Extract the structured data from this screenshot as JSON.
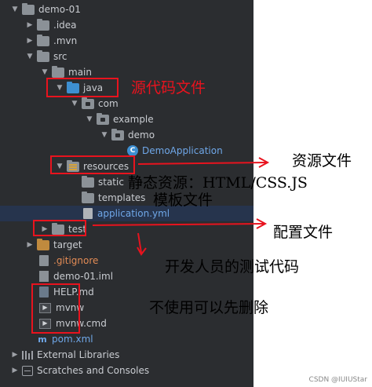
{
  "tree": {
    "root": "demo-01",
    "idea": ".idea",
    "mvn": ".mvn",
    "src": "src",
    "main": "main",
    "java": "java",
    "com": "com",
    "example": "example",
    "demo": "demo",
    "app_class": "DemoApplication",
    "app_class_icon": "C",
    "resources": "resources",
    "static": "static",
    "templates": "templates",
    "app_yml": "application.yml",
    "test": "test",
    "target": "target",
    "gitignore": ".gitignore",
    "iml": "demo-01.iml",
    "help": "HELP.md",
    "mvnw": "mvnw",
    "mvnw_cmd": "mvnw.cmd",
    "pom": "pom.xml",
    "external_libraries": "External Libraries",
    "scratches": "Scratches and Consoles",
    "pom_icon": "m",
    "mvnw_icon": "▶"
  },
  "annotations": {
    "source_files": "源代码文件",
    "resource_files": "资源文件",
    "static_resources": "静态资源：HTML/CSS.JS",
    "template_files": "模板文件",
    "config_files": "配置文件",
    "test_code": "开发人员的测试代码",
    "deletable": "不使用可以先删除"
  },
  "footer": "CSDN @IUIUStar",
  "colors": {
    "panel_bg": "#2b2d30",
    "annotation_red": "#e8131e",
    "selected_row": "#26344d",
    "folder_blue": "#3d8fd1",
    "ignored_orange": "#e28b55"
  }
}
